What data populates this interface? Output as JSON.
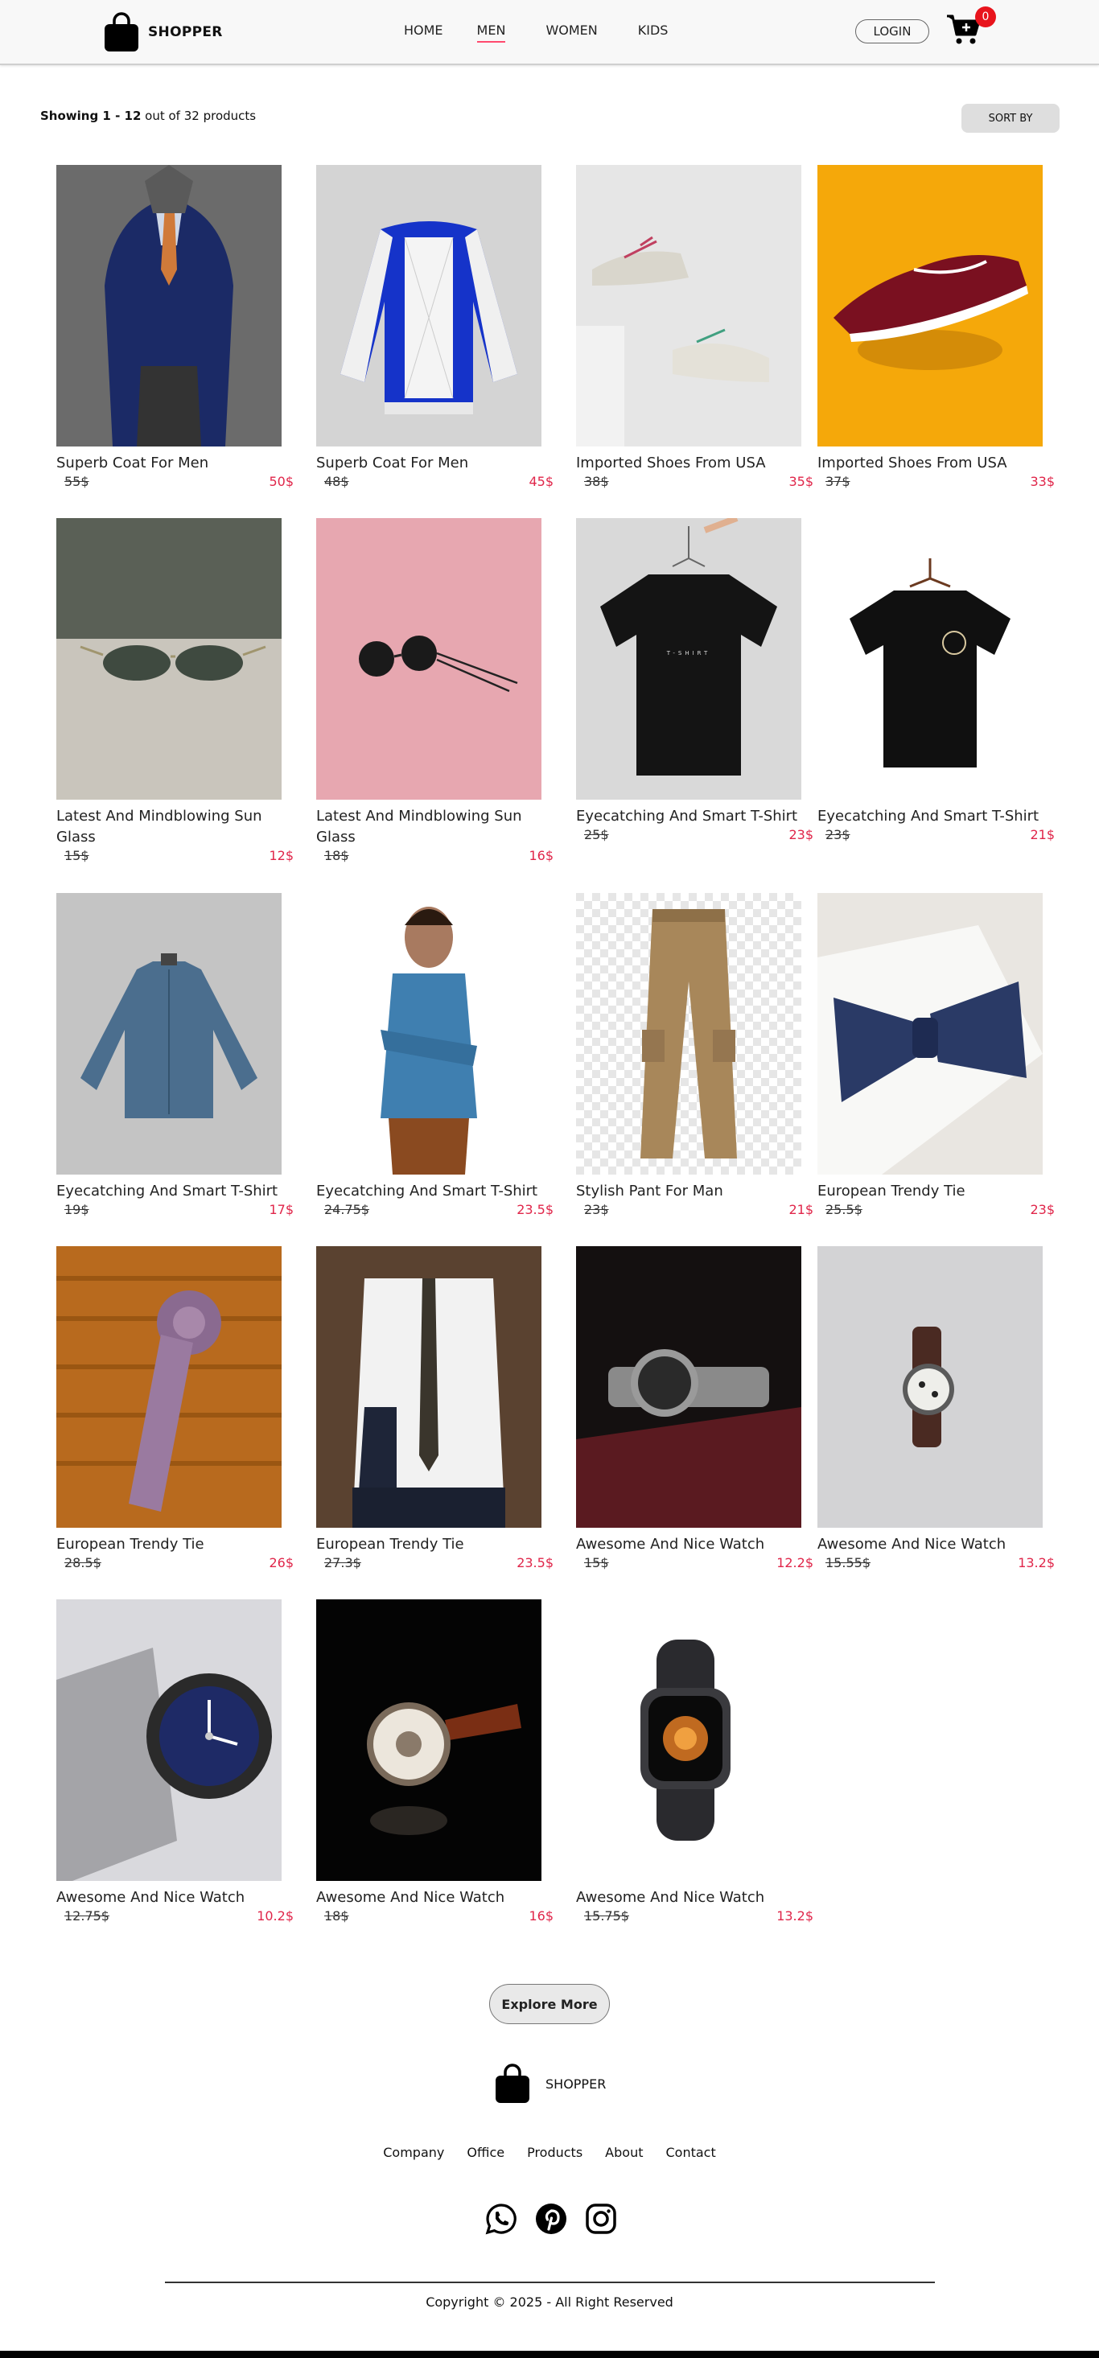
{
  "header": {
    "brand": "SHOPPER",
    "nav": [
      "HOME",
      "MEN",
      "WOMEN",
      "KIDS"
    ],
    "active_nav": "MEN",
    "login_label": "LOGIN",
    "cart_count": "0",
    "accent_color": "#ff4a6e",
    "badge_color": "#e8141c"
  },
  "toolbar": {
    "showing_bold": "Showing 1 - 12",
    "showing_rest": " out of 32 products",
    "sort_label": "SORT BY"
  },
  "products": [
    {
      "name": "Superb Coat For Men",
      "old": "55$",
      "new": "50$",
      "image": "navy-suit-man"
    },
    {
      "name": "Superb Coat For Men",
      "old": "48$",
      "new": "45$",
      "image": "blue-varsity-jacket"
    },
    {
      "name": "Imported Shoes From USA",
      "old": "38$",
      "new": "35$",
      "image": "white-sneakers"
    },
    {
      "name": "Imported Shoes From USA",
      "old": "37$",
      "new": "33$",
      "image": "maroon-sneaker"
    },
    {
      "name": "Latest And Mindblowing Sun Glass",
      "old": "15$",
      "new": "12$",
      "image": "aviator-sunglasses"
    },
    {
      "name": "Latest And Mindblowing Sun Glass",
      "old": "18$",
      "new": "16$",
      "image": "round-sunglasses-pink"
    },
    {
      "name": "Eyecatching And Smart T-Shirt",
      "old": "25$",
      "new": "23$",
      "image": "black-tshirt-hanger"
    },
    {
      "name": "Eyecatching And Smart T-Shirt",
      "old": "23$",
      "new": "21$",
      "image": "black-tshirt-logo"
    },
    {
      "name": "Eyecatching And Smart T-Shirt",
      "old": "19$",
      "new": "17$",
      "image": "denim-shirt"
    },
    {
      "name": "Eyecatching And Smart T-Shirt",
      "old": "24.75$",
      "new": "23.5$",
      "image": "man-denim-shirt"
    },
    {
      "name": "Stylish Pant For Man",
      "old": "23$",
      "new": "21$",
      "image": "cargo-pants"
    },
    {
      "name": "European Trendy Tie",
      "old": "25.5$",
      "new": "23$",
      "image": "navy-bow-tie"
    },
    {
      "name": "European Trendy Tie",
      "old": "28.5$",
      "new": "26$",
      "image": "rolled-tie"
    },
    {
      "name": "European Trendy Tie",
      "old": "27.3$",
      "new": "23.5$",
      "image": "man-white-shirt-tie"
    },
    {
      "name": "Awesome And Nice Watch",
      "old": "15$",
      "new": "12.2$",
      "image": "steel-watch-book"
    },
    {
      "name": "Awesome And Nice Watch",
      "old": "15.55$",
      "new": "13.2$",
      "image": "leather-watch"
    },
    {
      "name": "Awesome And Nice Watch",
      "old": "12.75$",
      "new": "10.2$",
      "image": "diver-watch"
    },
    {
      "name": "Awesome And Nice Watch",
      "old": "18$",
      "new": "16$",
      "image": "skeleton-watch"
    },
    {
      "name": "Awesome And Nice Watch",
      "old": "15.75$",
      "new": "13.2$",
      "image": "smart-watch"
    }
  ],
  "explore_label": "Explore More",
  "footer": {
    "brand": "SHOPPER",
    "links": [
      "Company",
      "Office",
      "Products",
      "About",
      "Contact"
    ],
    "socials": [
      "whatsapp-icon",
      "pinterest-icon",
      "instagram-icon"
    ],
    "copyright": "Copyright © 2025 - All Right Reserved"
  },
  "price_color": "#e0264a"
}
